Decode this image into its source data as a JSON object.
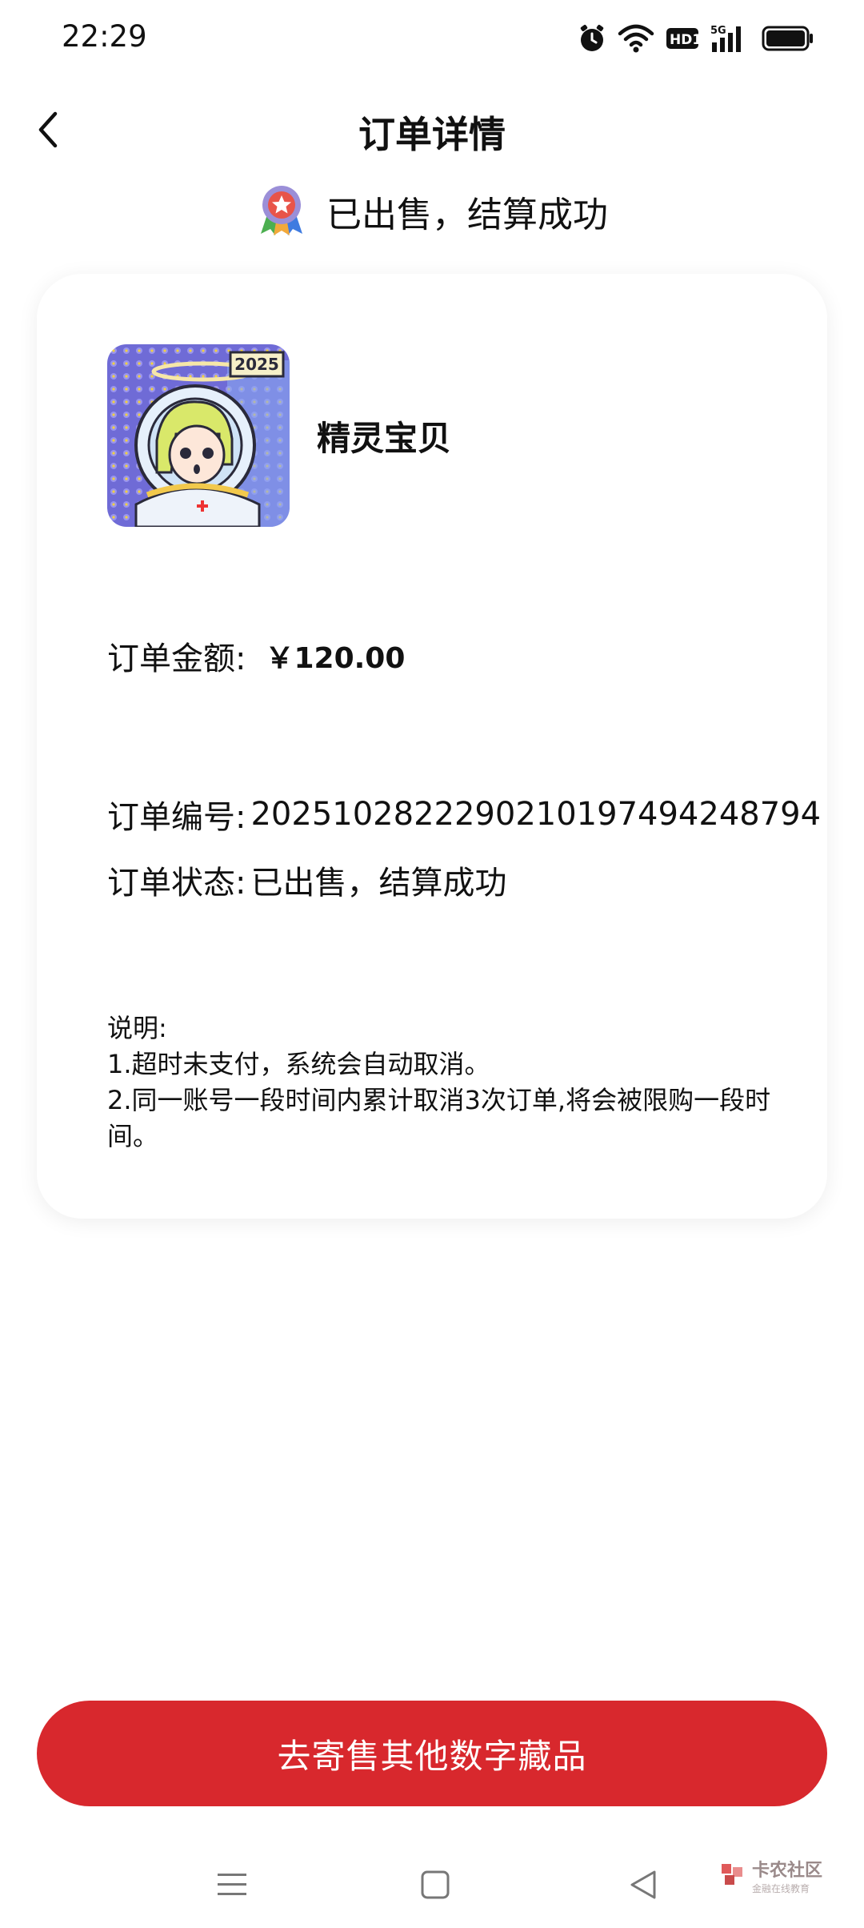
{
  "status_bar": {
    "time": "22:29",
    "icons": [
      "alarm-icon",
      "wifi-icon",
      "hd-icon",
      "signal-5g-icon",
      "battery-icon"
    ],
    "hd_label": "HD1",
    "network_label": "5G"
  },
  "nav": {
    "title": "订单详情",
    "back_icon": "chevron-left-icon"
  },
  "banner": {
    "icon": "medal-icon",
    "text": "已出售，结算成功"
  },
  "product": {
    "name": "精灵宝贝",
    "image_badge": "2025"
  },
  "order": {
    "amount_label": "订单金额:",
    "amount_value": "￥120.00",
    "number_label": "订单编号:",
    "number_value": "20251028222902101974942487​94",
    "status_label": "订单状态:",
    "status_value": "已出售，结算成功"
  },
  "notes": {
    "heading": "说明:",
    "line1": "1.超时未支付，系统会自动取消。",
    "line2": "2.同一账号一段时间内累计取消3次订单,将会被限购一段时间。"
  },
  "cta": {
    "label": "去寄售其他数字藏品"
  },
  "system_nav": {
    "icons": [
      "menu-icon",
      "home-square-icon",
      "back-triangle-icon"
    ]
  },
  "watermark": {
    "main": "卡农社区",
    "sub": "金融在线教育"
  },
  "colors": {
    "accent": "#d8282d",
    "background": "#ffffff",
    "text": "#111111"
  }
}
